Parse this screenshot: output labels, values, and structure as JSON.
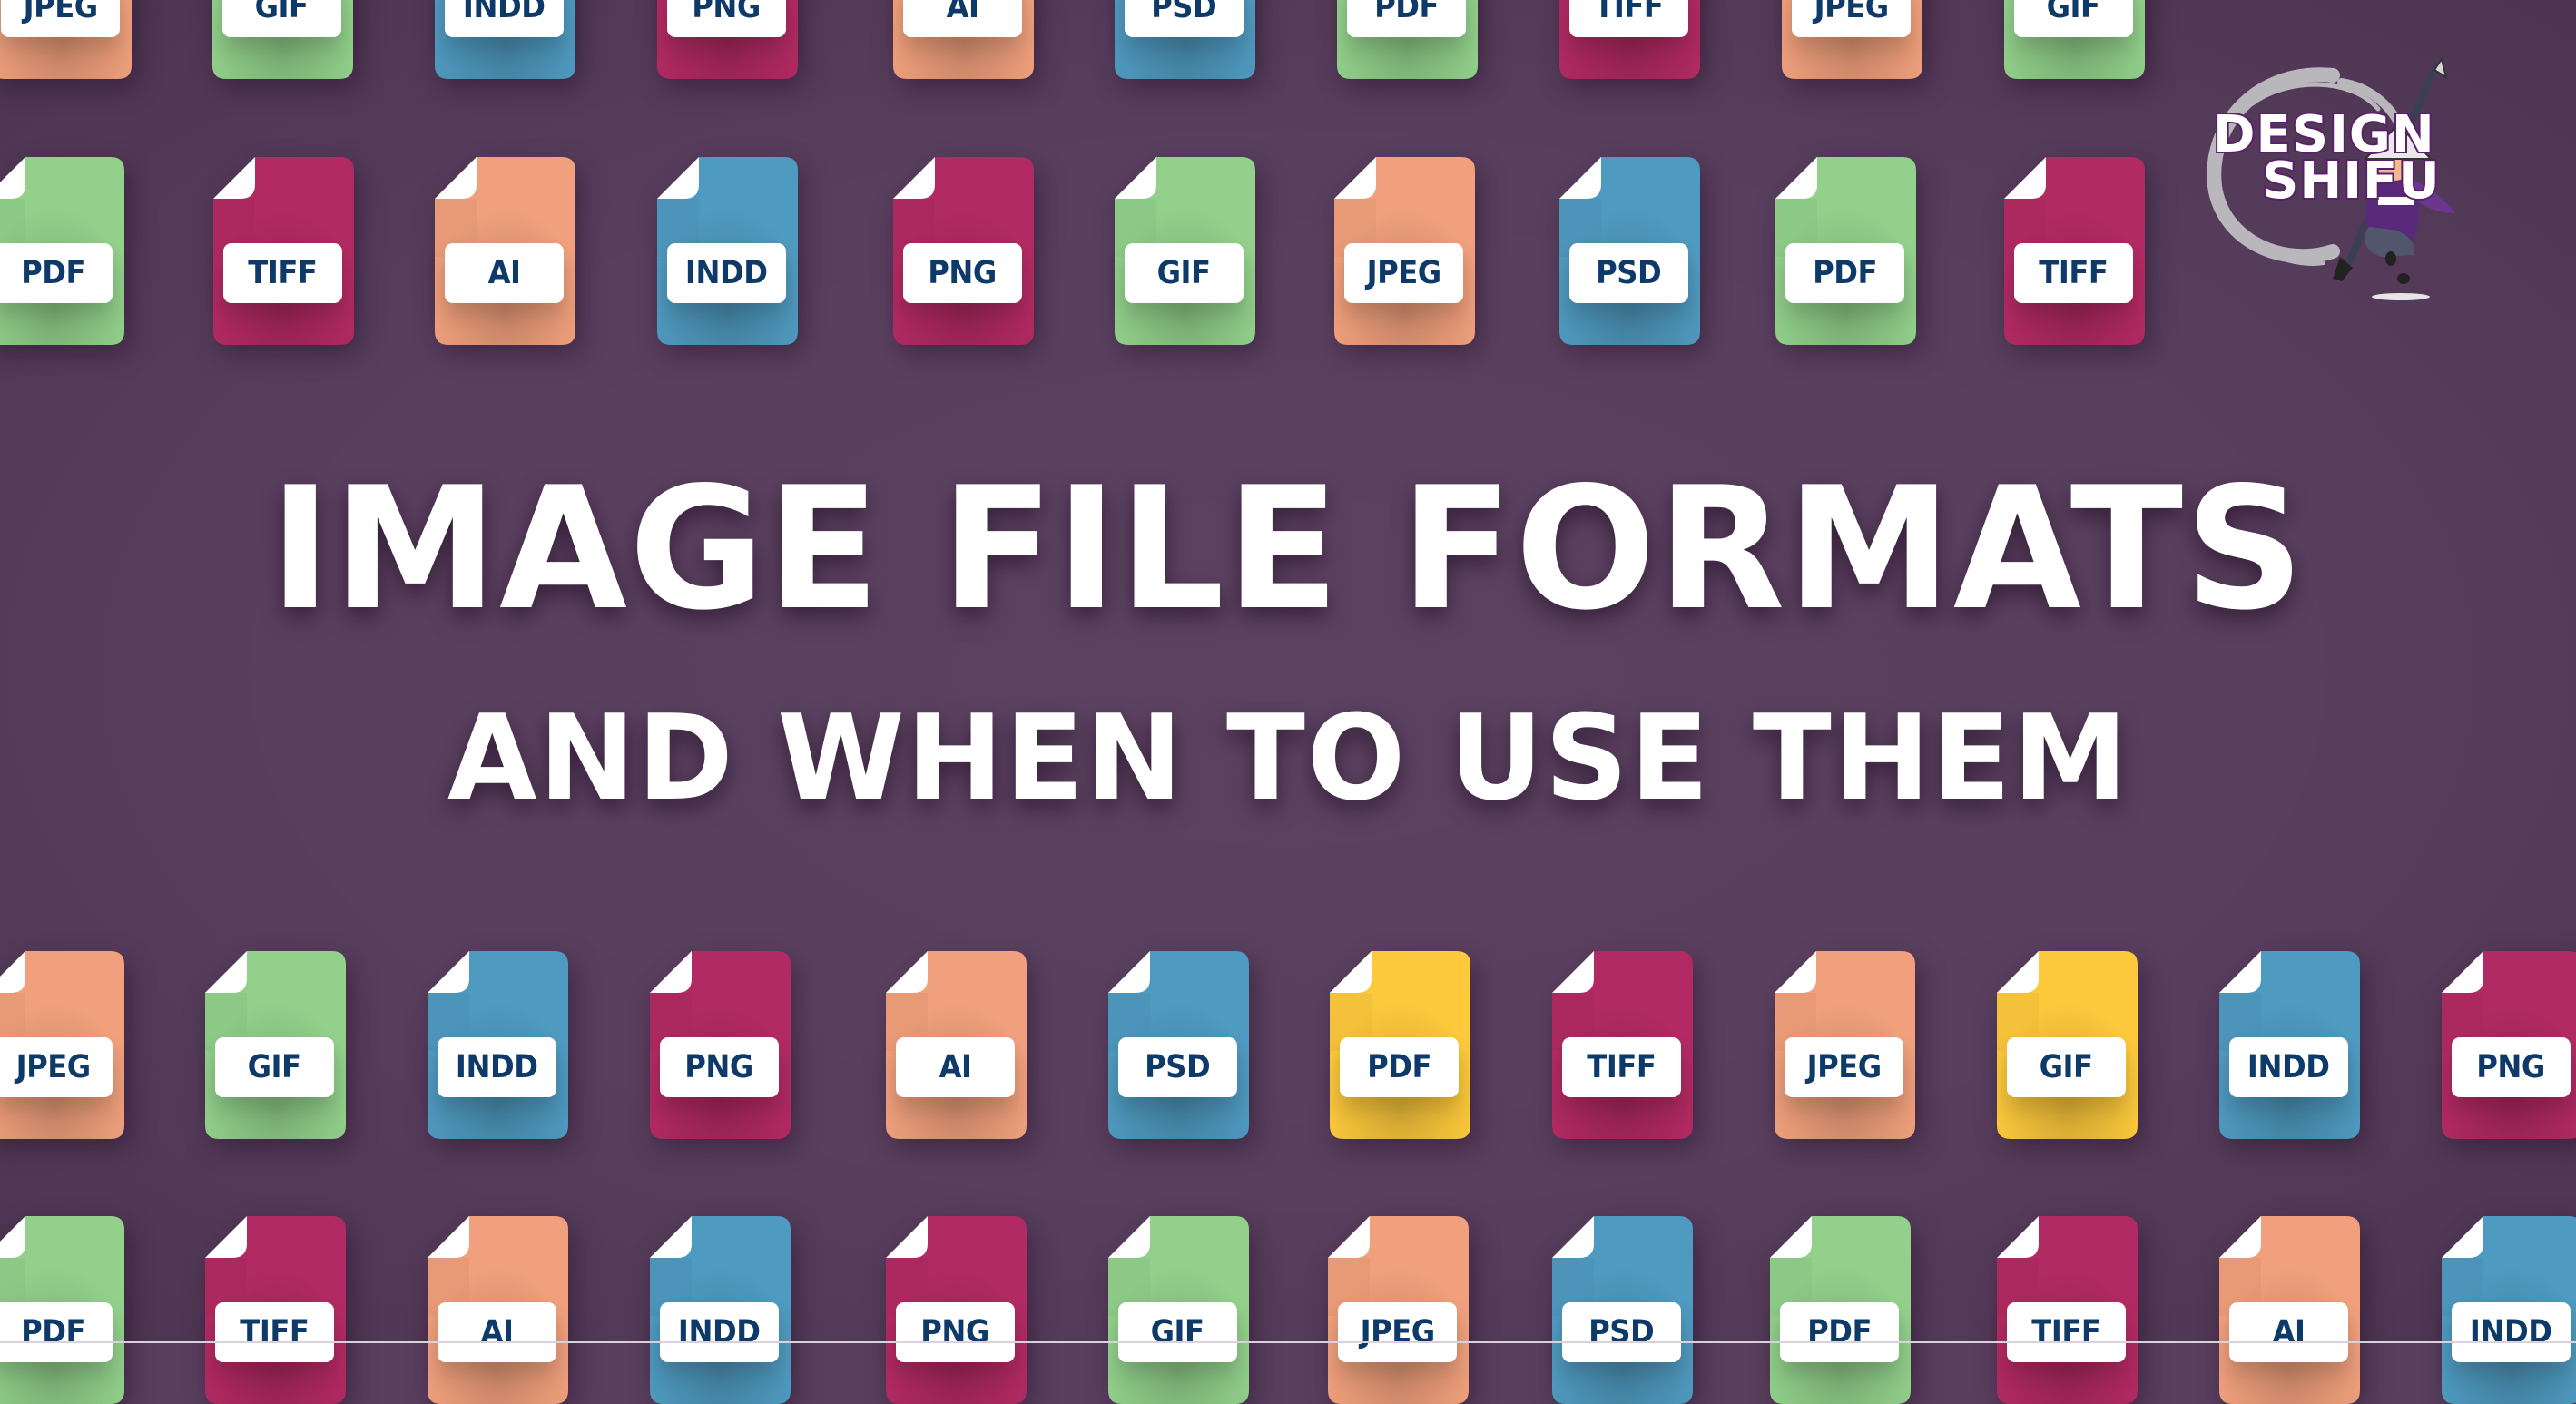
{
  "title": {
    "line1": "IMAGE FILE FORMATS",
    "line2": "AND WHEN TO USE THEM"
  },
  "logo": {
    "line1": "DESIGN",
    "line2": "SHIFU",
    "icon": "shifu-mascot-icon"
  },
  "colors": {
    "background": "#593f5e",
    "orange": "#f0a07c",
    "green": "#92d08b",
    "blue": "#4f9ac0",
    "magenta": "#b22a63",
    "yellow": "#fcc93c",
    "label_text": "#0e3a6a",
    "label_bg": "#ffffff",
    "logo_outline": "#5b1f6b"
  },
  "rows": [
    {
      "icons": [
        {
          "label": "JPEG",
          "color": "orange"
        },
        {
          "label": "GIF",
          "color": "green"
        },
        {
          "label": "INDD",
          "color": "blue"
        },
        {
          "label": "PNG",
          "color": "magenta"
        },
        {
          "label": "AI",
          "color": "orange"
        },
        {
          "label": "PSD",
          "color": "blue"
        },
        {
          "label": "PDF",
          "color": "green"
        },
        {
          "label": "TIFF",
          "color": "magenta"
        },
        {
          "label": "JPEG",
          "color": "orange"
        },
        {
          "label": "GIF",
          "color": "green"
        }
      ]
    },
    {
      "icons": [
        {
          "label": "PDF",
          "color": "green"
        },
        {
          "label": "TIFF",
          "color": "magenta"
        },
        {
          "label": "AI",
          "color": "orange"
        },
        {
          "label": "INDD",
          "color": "blue"
        },
        {
          "label": "PNG",
          "color": "magenta"
        },
        {
          "label": "GIF",
          "color": "green"
        },
        {
          "label": "JPEG",
          "color": "orange"
        },
        {
          "label": "PSD",
          "color": "blue"
        },
        {
          "label": "PDF",
          "color": "green"
        },
        {
          "label": "TIFF",
          "color": "magenta"
        }
      ]
    },
    {
      "icons": [
        {
          "label": "JPEG",
          "color": "orange"
        },
        {
          "label": "GIF",
          "color": "green"
        },
        {
          "label": "INDD",
          "color": "blue"
        },
        {
          "label": "PNG",
          "color": "magenta"
        },
        {
          "label": "AI",
          "color": "orange"
        },
        {
          "label": "PSD",
          "color": "blue"
        },
        {
          "label": "PDF",
          "color": "yellow"
        },
        {
          "label": "TIFF",
          "color": "magenta"
        },
        {
          "label": "JPEG",
          "color": "orange"
        },
        {
          "label": "GIF",
          "color": "yellow"
        },
        {
          "label": "INDD",
          "color": "blue"
        },
        {
          "label": "PNG",
          "color": "magenta"
        }
      ]
    },
    {
      "icons": [
        {
          "label": "PDF",
          "color": "green"
        },
        {
          "label": "TIFF",
          "color": "magenta"
        },
        {
          "label": "AI",
          "color": "orange"
        },
        {
          "label": "INDD",
          "color": "blue"
        },
        {
          "label": "PNG",
          "color": "magenta"
        },
        {
          "label": "GIF",
          "color": "green"
        },
        {
          "label": "JPEG",
          "color": "orange"
        },
        {
          "label": "PSD",
          "color": "blue"
        },
        {
          "label": "PDF",
          "color": "green"
        },
        {
          "label": "TIFF",
          "color": "magenta"
        },
        {
          "label": "AI",
          "color": "orange"
        },
        {
          "label": "INDD",
          "color": "blue"
        }
      ]
    }
  ]
}
